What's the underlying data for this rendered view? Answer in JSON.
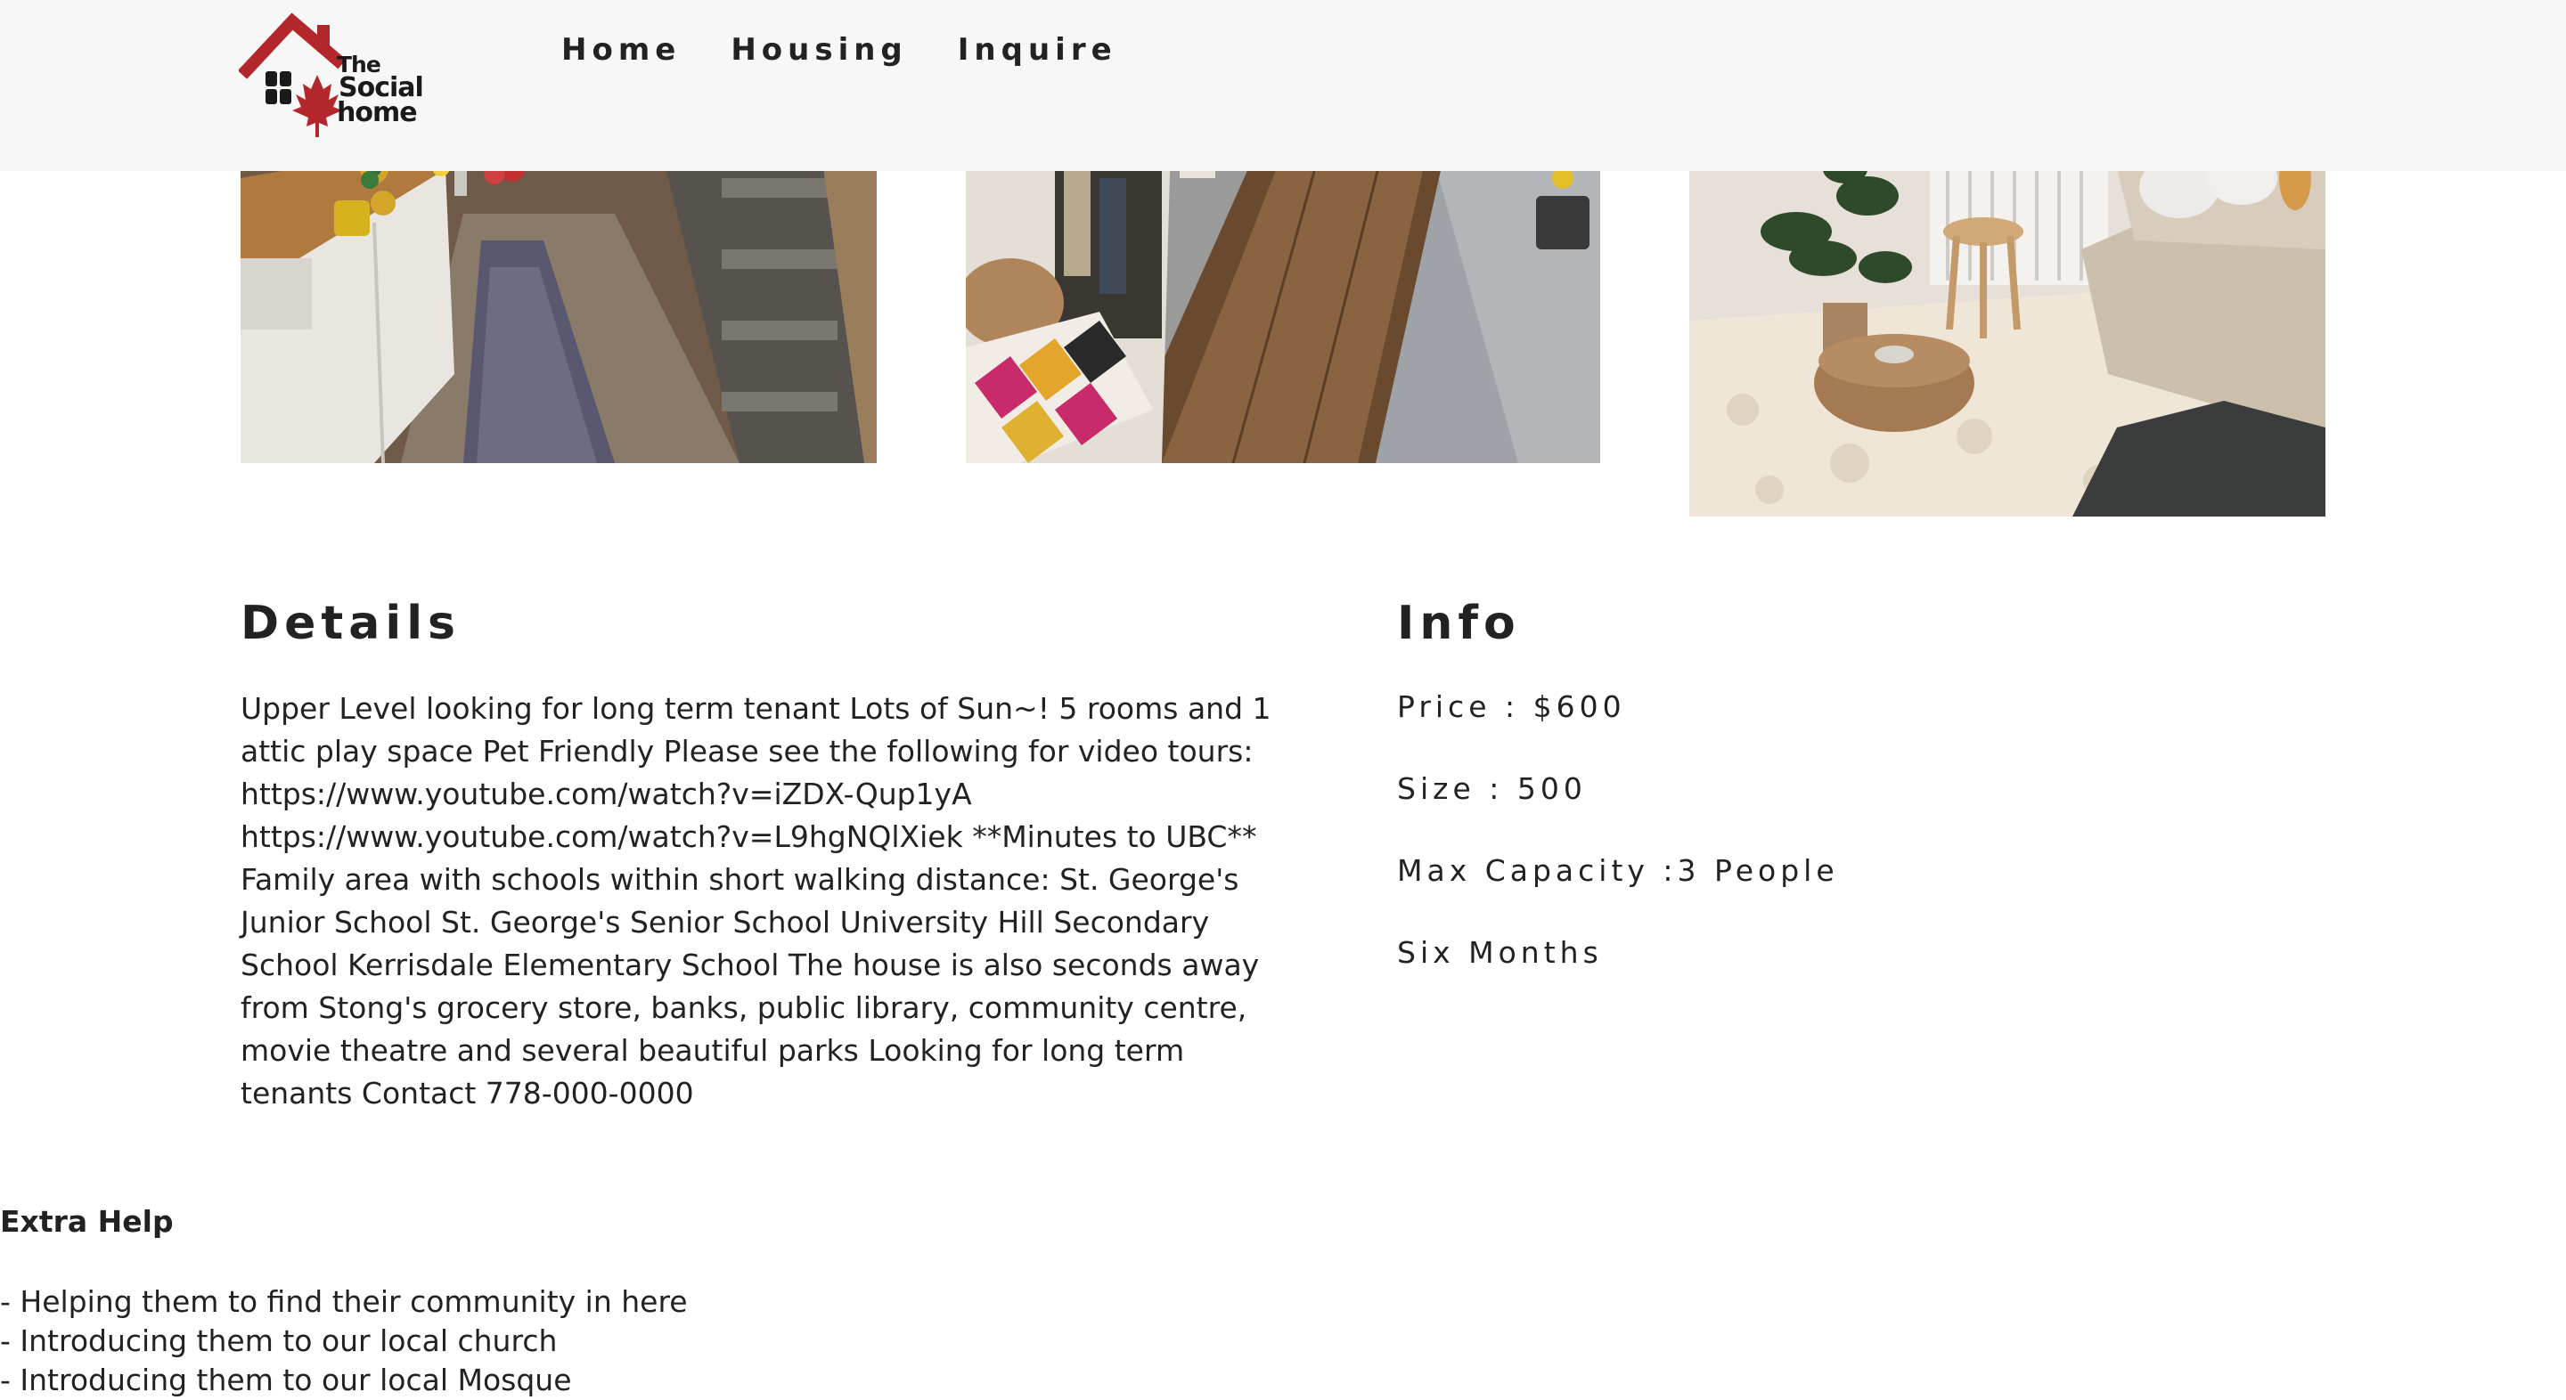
{
  "header": {
    "logo": {
      "line1": "The",
      "line2": "Social",
      "line3": "home"
    },
    "nav": [
      {
        "label": "Home"
      },
      {
        "label": "Housing"
      },
      {
        "label": "Inquire"
      }
    ]
  },
  "gallery": {
    "photos": [
      {
        "subject": "tiny home kitchen with staircase"
      },
      {
        "subject": "tiny home hallway with rug"
      },
      {
        "subject": "living room with shag rug"
      }
    ]
  },
  "details": {
    "title": "Details",
    "body": "Upper Level looking for long term tenant Lots of Sun~! 5 rooms and 1 attic play space Pet Friendly Please see the following for video tours: https://www.youtube.com/watch?v=iZDX-Qup1yA https://www.youtube.com/watch?v=L9hgNQlXiek **Minutes to UBC** Family area with schools within short walking distance: St. George's Junior School St. George's Senior School University Hill Secondary School Kerrisdale Elementary School The house is also seconds away from Stong's grocery store, banks, public library, community centre, movie theatre and several beautiful parks Looking for long term tenants Contact 778-000-0000"
  },
  "info": {
    "title": "Info",
    "price": "Price : $600",
    "size": "Size : 500",
    "capacity": "Max Capacity :3 People",
    "term": "Six Months"
  },
  "extra_help": {
    "title": "Extra Help",
    "items": [
      "- Helping them to find their community in here",
      "- Introducing them to our local church",
      "- Introducing them to our local Mosque"
    ]
  },
  "colors": {
    "header_bg": "#f7f7f7",
    "logo_red": "#b3262b",
    "text": "#222222"
  }
}
